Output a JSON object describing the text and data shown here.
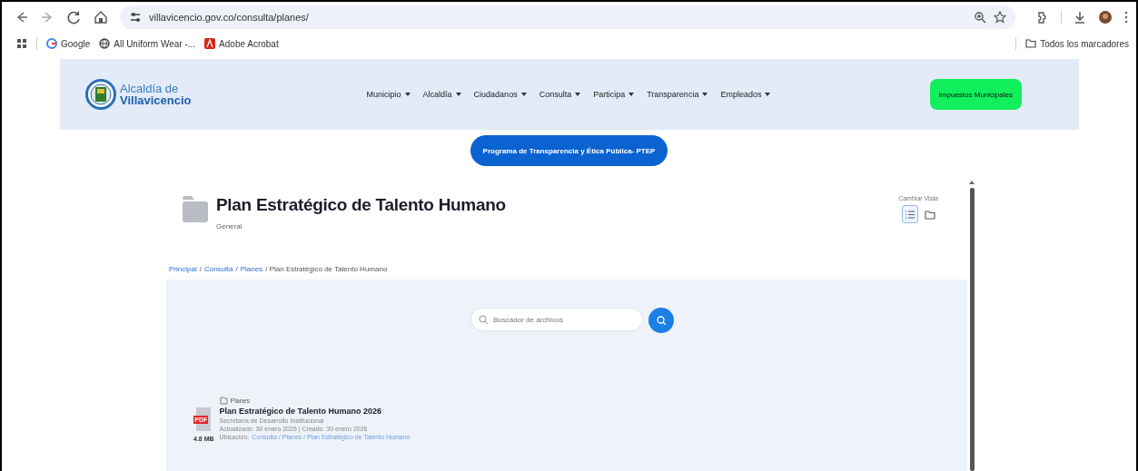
{
  "browser": {
    "url": "villavicencio.gov.co/consulta/planes/",
    "bookmarks": [
      "Google",
      "All Uniform Wear -...",
      "Adobe Acrobat"
    ],
    "all_bookmarks": "Todos los marcadores"
  },
  "header": {
    "logo_line1": "Alcaldía de",
    "logo_line2": "Villavicencio",
    "nav": [
      "Municipio",
      "Alcaldía",
      "Ciudadanos",
      "Consulta",
      "Participa",
      "Transparencia",
      "Empleados"
    ],
    "cta": "Impuestos Municipales"
  },
  "banner_button": "Programa de Transparencia y Ética Pública- PTEP",
  "folder": {
    "title": "Plan Estratégico de Talento Humano",
    "subtitle": "General",
    "view_label": "Cambiar Vista",
    "views": [
      {
        "kind": "list",
        "selected": true
      },
      {
        "kind": "folder",
        "selected": false
      }
    ]
  },
  "breadcrumb": [
    {
      "label": "Principal",
      "link": true
    },
    {
      "label": "/",
      "link": false
    },
    {
      "label": "Consulta",
      "link": true
    },
    {
      "label": "/",
      "link": false
    },
    {
      "label": "Planes",
      "link": true
    },
    {
      "label": "/ Plan Estratégico de Talento Humano",
      "link": false
    }
  ],
  "search": {
    "placeholder": "Buscador de archivos"
  },
  "files": [
    {
      "category": "Planes",
      "badge": "PDF",
      "size": "4.8 MB",
      "title": "Plan Estratégico de Talento Humano 2026",
      "owner": "Secretaría de Desarrollo Institucional",
      "dates": "Actualizado: 30 enero 2026 | Creado: 30 enero 2026",
      "location_label": "Ubicación:",
      "location": "Consulta / Planes / Plan Estratégico de Talento Humano"
    }
  ]
}
